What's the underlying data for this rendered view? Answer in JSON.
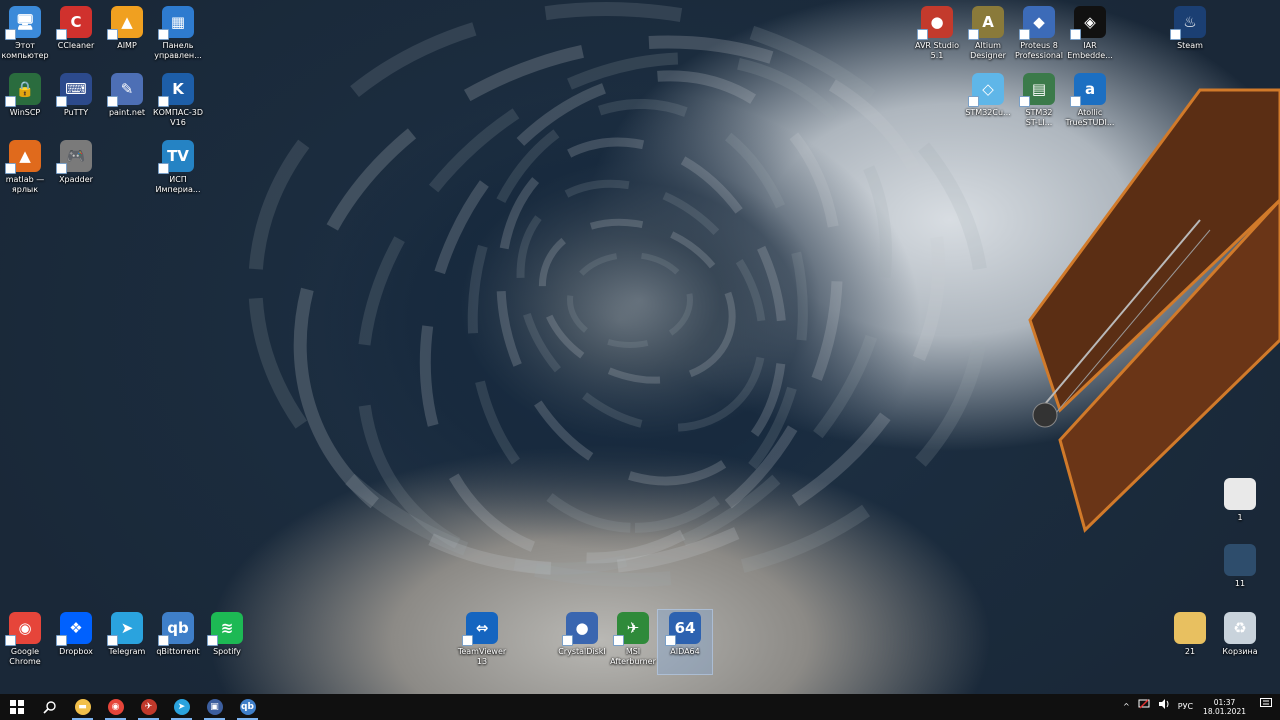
{
  "desktop": {
    "icons_top_left": [
      {
        "id": "this-pc",
        "label": "Этот\nкомпьютер",
        "glyph": "🖥",
        "color": "#3b8ad9"
      },
      {
        "id": "ccleaner",
        "label": "CCleaner",
        "glyph": "C",
        "color": "#d0312d"
      },
      {
        "id": "aimp",
        "label": "AIMP",
        "glyph": "▲",
        "color": "#f0a020"
      },
      {
        "id": "control-panel",
        "label": "Панель\nуправлен...",
        "glyph": "▦",
        "color": "#2e7bcf"
      },
      {
        "id": "winscp",
        "label": "WinSCP",
        "glyph": "🔒",
        "color": "#2a6c3e"
      },
      {
        "id": "putty",
        "label": "PuTTY",
        "glyph": "⌨",
        "color": "#2c4a8c"
      },
      {
        "id": "paintnet",
        "label": "paint.net",
        "glyph": "✎",
        "color": "#4d6fb5"
      },
      {
        "id": "kompas",
        "label": "КОМПАС-3D\nV16",
        "glyph": "K",
        "color": "#1d5ea8"
      },
      {
        "id": "matlab",
        "label": "matlab —\nярлык",
        "glyph": "▲",
        "color": "#e06a1c"
      },
      {
        "id": "xpadder",
        "label": "Xpadder",
        "glyph": "🎮",
        "color": "#7a7a7a"
      },
      {
        "id": "isp-imperia",
        "label": "ИСП\nИмпериа...",
        "glyph": "TV",
        "color": "#2583c4"
      }
    ],
    "icons_top_right": [
      {
        "id": "avr-studio",
        "label": "AVR Studio\n5.1",
        "glyph": "●",
        "color": "#c33a2c"
      },
      {
        "id": "altium",
        "label": "Altium\nDesigner",
        "glyph": "A",
        "color": "#8a7a3a"
      },
      {
        "id": "proteus",
        "label": "Proteus 8\nProfessional",
        "glyph": "◆",
        "color": "#3c6bb8"
      },
      {
        "id": "iar",
        "label": "IAR\nEmbedde...",
        "glyph": "◈",
        "color": "#111111"
      },
      {
        "id": "steam",
        "label": "Steam",
        "glyph": "♨",
        "color": "#1b3f73"
      },
      {
        "id": "stm32cube",
        "label": "STM32Cu...",
        "glyph": "◇",
        "color": "#5fb6e8"
      },
      {
        "id": "stm32-st-link",
        "label": "STM32\nST-LI...",
        "glyph": "▤",
        "color": "#3b7a4a"
      },
      {
        "id": "atollic",
        "label": "Atollic\nTrueSTUDI...",
        "glyph": "a",
        "color": "#1c6fc2"
      }
    ],
    "icons_right_column": [
      {
        "id": "file-1",
        "label": "1",
        "glyph": "",
        "color": "#e9e9e9"
      },
      {
        "id": "file-11",
        "label": "11",
        "glyph": "",
        "color": "#2e4d6c"
      },
      {
        "id": "folder-21",
        "label": "21",
        "glyph": "",
        "color": "#e8c060"
      },
      {
        "id": "recycle-bin",
        "label": "Корзина",
        "glyph": "♻",
        "color": "#c9d3dc"
      }
    ],
    "icons_bottom": [
      {
        "id": "google-chrome",
        "label": "Google\nChrome",
        "glyph": "◉",
        "color": "#e6453a"
      },
      {
        "id": "dropbox",
        "label": "Dropbox",
        "glyph": "❖",
        "color": "#0061fe"
      },
      {
        "id": "telegram",
        "label": "Telegram",
        "glyph": "➤",
        "color": "#2aa3de"
      },
      {
        "id": "qbittorrent",
        "label": "qBittorrent",
        "glyph": "qb",
        "color": "#3f7fc9"
      },
      {
        "id": "spotify",
        "label": "Spotify",
        "glyph": "≋",
        "color": "#1db954"
      },
      {
        "id": "teamviewer",
        "label": "TeamViewer\n13",
        "glyph": "⇔",
        "color": "#1565c0"
      },
      {
        "id": "crystaldisk",
        "label": "CrystalDiskI",
        "glyph": "●",
        "color": "#3a66b0"
      },
      {
        "id": "msi-afterburner",
        "label": "MSI\nAfterburner",
        "glyph": "✈",
        "color": "#2f8a3a"
      },
      {
        "id": "aida64",
        "label": "AIDA64",
        "glyph": "64",
        "color": "#2d62b0"
      }
    ]
  },
  "taskbar": {
    "start_icon": "windows-logo-icon",
    "search_icon": "search-icon",
    "pinned": [
      {
        "id": "explorer",
        "glyph": "▬",
        "color": "#f2c04a"
      },
      {
        "id": "chrome",
        "glyph": "◉",
        "color": "#e6453a"
      },
      {
        "id": "app-3",
        "glyph": "✈",
        "color": "#c0392b"
      },
      {
        "id": "telegram",
        "glyph": "➤",
        "color": "#2aa3de"
      },
      {
        "id": "app-5",
        "glyph": "▣",
        "color": "#3c5e9e"
      },
      {
        "id": "qbittorrent",
        "glyph": "qb",
        "color": "#3f7fc9"
      }
    ],
    "tray": {
      "chevron": "^",
      "language": "РУС",
      "time": "01:37",
      "date": "18.01.2021"
    }
  }
}
